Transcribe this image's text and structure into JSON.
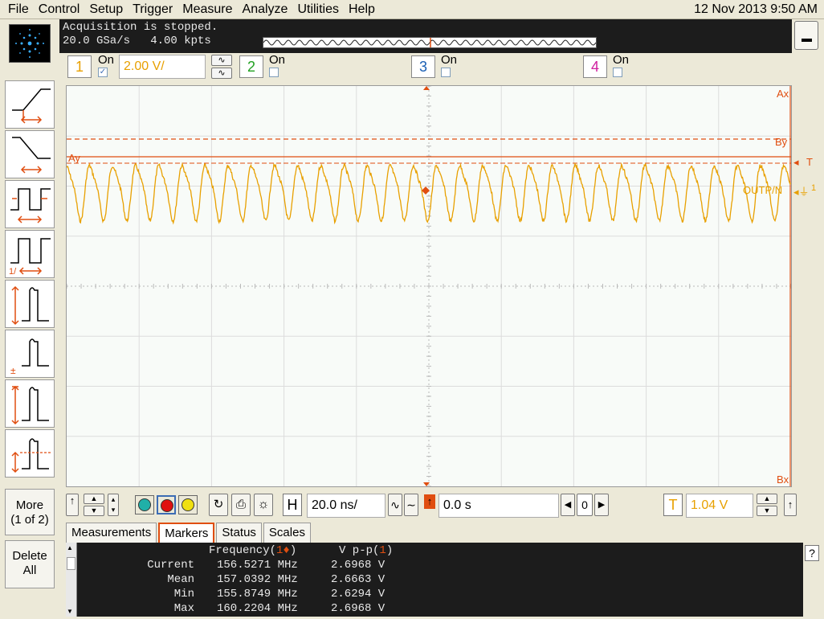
{
  "menu": [
    "File",
    "Control",
    "Setup",
    "Trigger",
    "Measure",
    "Analyze",
    "Utilities",
    "Help"
  ],
  "datetime": "12 Nov 2013  9:50 AM",
  "acquisition": {
    "status": "Acquisition is stopped.",
    "rate": "20.0 GSa/s   4.00 kpts"
  },
  "channels": [
    {
      "number": "1",
      "on_label": "On",
      "checked": true,
      "color": "#e8a000",
      "scale": "2.00 V/"
    },
    {
      "number": "2",
      "on_label": "On",
      "checked": false,
      "color": "#21a121"
    },
    {
      "number": "3",
      "on_label": "On",
      "checked": false,
      "color": "#1a5fb4"
    },
    {
      "number": "4",
      "on_label": "On",
      "checked": false,
      "color": "#d020a0"
    }
  ],
  "tools": {
    "more_label": "More\n(1 of 2)",
    "delete_label": "Delete\nAll"
  },
  "graticule": {
    "markers": {
      "ax": "Ax",
      "by": "By",
      "ay": "Ay",
      "bx": "Bx",
      "t": "T"
    },
    "waveform_label": "OUTP/N",
    "ground_label": "1"
  },
  "controls": {
    "horizontal_label": "H",
    "horizontal_scale": "20.0 ns/",
    "position": "0.0 s",
    "zoom_value": "0",
    "trigger_label": "T",
    "trigger_level": "1.04 V"
  },
  "measurements": {
    "tabs": [
      "Measurements",
      "Markers",
      "Status",
      "Scales"
    ],
    "active_tab": "Markers",
    "col1_header": "Frequency(",
    "col1_source": "1",
    "col1_symbol": "♦",
    "col1_close": ")",
    "col2_header": "V p-p(",
    "col2_source": "1",
    "col2_close": ")",
    "rows": [
      {
        "label": "Current",
        "freq": "156.5271 MHz",
        "vpp": "2.6968 V"
      },
      {
        "label": "Mean",
        "freq": "157.0392 MHz",
        "vpp": "2.6663 V"
      },
      {
        "label": "Min",
        "freq": "155.8749 MHz",
        "vpp": "2.6294 V"
      },
      {
        "label": "Max",
        "freq": "160.2204 MHz",
        "vpp": "2.6968 V"
      }
    ]
  },
  "colors": {
    "waveform": "#e8a000",
    "marker": "#e04e10",
    "panel_dark": "#1c1c1c"
  }
}
